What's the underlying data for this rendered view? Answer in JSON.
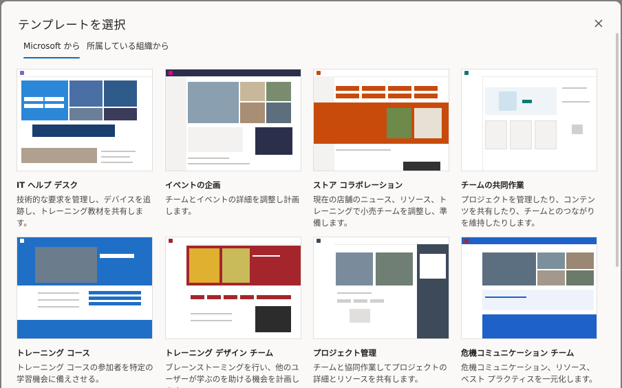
{
  "dialog": {
    "title": "テンプレートを選択",
    "tabs": [
      {
        "label": "Microsoft から",
        "active": true
      },
      {
        "label": "所属している組織から",
        "active": false
      }
    ]
  },
  "templates": [
    {
      "title": "IT ヘルプ デスク",
      "desc": "技術的な要求を管理し、デバイスを追跡し、トレーニング教材を共有します。"
    },
    {
      "title": "イベントの企画",
      "desc": "チームとイベントの詳細を調整し計画します。"
    },
    {
      "title": "ストア コラボレーション",
      "desc": "現在の店舗のニュース、リソース、トレーニングで小売チームを調整し、準備します。"
    },
    {
      "title": "チームの共同作業",
      "desc": "プロジェクトを管理したり、コンテンツを共有したり、チームとのつながりを維持したりします。"
    },
    {
      "title": "トレーニング コース",
      "desc": "トレーニング コースの参加者を特定の学習機会に備えさせる。"
    },
    {
      "title": "トレーニング デザイン チーム",
      "desc": "ブレーンストーミングを行い、他のユーザーが学ぶのを助ける機会を計画します。"
    },
    {
      "title": "プロジェクト管理",
      "desc": "チームと協同作業してプロジェクトの詳細とリソースを共有します。"
    },
    {
      "title": "危機コミュニケーション チーム",
      "desc": "危機コミュニケーション、リソース、ベスト プラクティスを一元化します。"
    }
  ],
  "colors": {
    "accent": "#0f6cbd",
    "it_blue": "#2b88d8",
    "event_navy": "#2c2f4a",
    "store_orange": "#c84b0b",
    "team_teal": "#0e7a70",
    "training_blue": "#1f6fc7",
    "design_red": "#a4262c",
    "project_slate": "#3c4a5a",
    "crisis_blue": "#1e61c9"
  },
  "icons": {
    "close": "close-icon"
  }
}
